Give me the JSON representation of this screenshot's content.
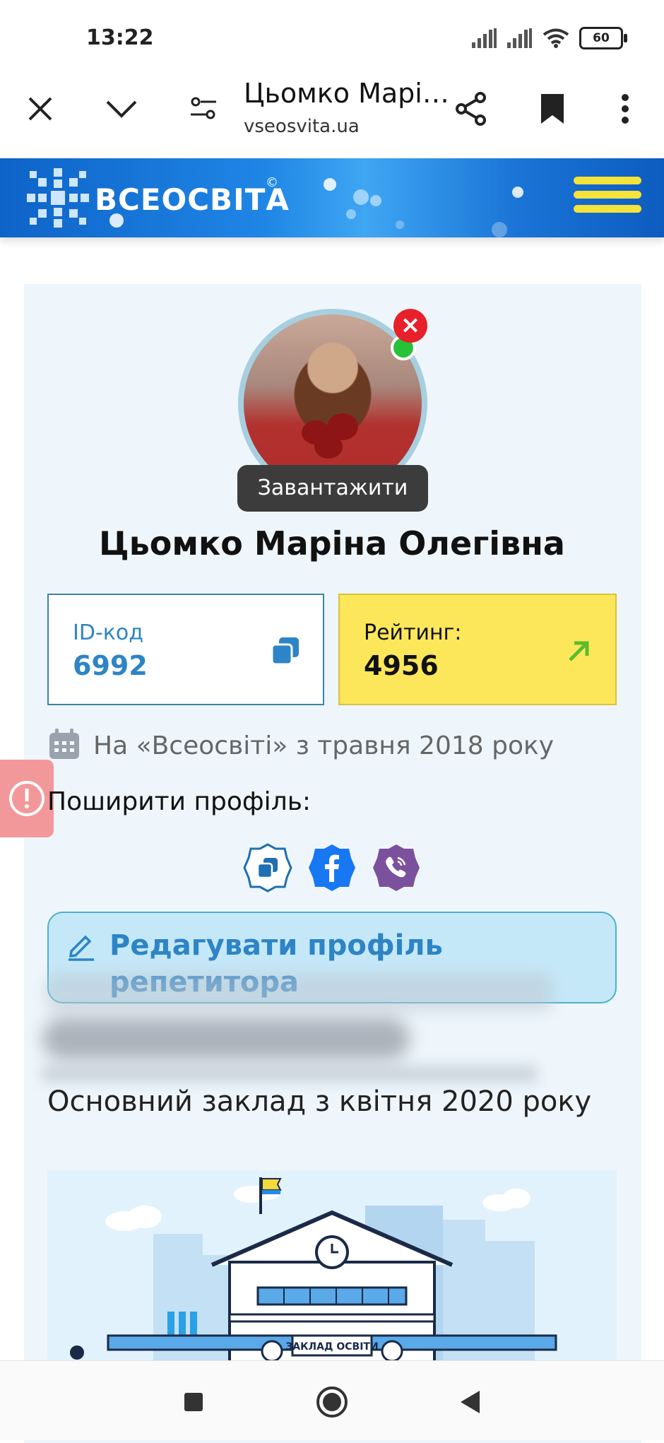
{
  "status_bar": {
    "time": "13:22",
    "battery": "60",
    "icons": [
      "signal-icon",
      "signal-icon",
      "wifi-icon",
      "battery-icon"
    ]
  },
  "browser": {
    "title": "Цьомко Марі…",
    "domain": "vseosvita.ua",
    "icons": [
      "close-icon",
      "chevron-down-icon",
      "site-settings-icon",
      "share-icon",
      "bookmark-icon",
      "more-icon"
    ]
  },
  "site": {
    "logo_text": "ВСЕОСВІТА",
    "logo_mark": "©",
    "accent": "#2d84c6",
    "menu_color": "#f5e23a"
  },
  "profile": {
    "upload_label": "Завантажити",
    "name": "Цьомко Маріна Олегівна",
    "id_label": "ID-код",
    "id_value": "6992",
    "rating_label": "Рейтинг:",
    "rating_value": "4956",
    "since": "На «Всеосвіті» з травня 2018 року",
    "share_label": "Поширити профіль:",
    "share_buttons": [
      "copy-link-icon",
      "facebook-icon",
      "viber-icon"
    ],
    "edit_label_line1": "Редагувати профіль",
    "edit_label_line2": "репетитора",
    "institution": "Основний заклад з квітня 2020 року",
    "illustration_sign": "ЗАКЛАД ОСВІТИ"
  },
  "colors": {
    "rating_bg": "#fce75a",
    "card_bg": "#eef6fc",
    "edit_bg": "#c5e8f9",
    "facebook": "#1877f2",
    "viber": "#7b519d"
  }
}
